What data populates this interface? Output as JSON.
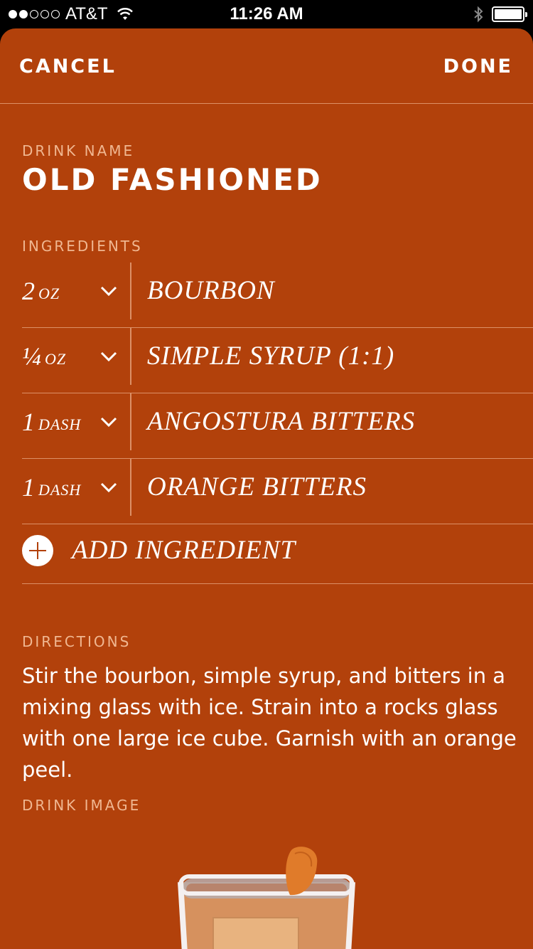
{
  "status_bar": {
    "carrier": "AT&T",
    "time": "11:26 AM",
    "signal_bars_filled": 2,
    "signal_bars_total": 5
  },
  "nav": {
    "cancel_label": "CANCEL",
    "done_label": "DONE"
  },
  "drink": {
    "name_label": "DRINK NAME",
    "name": "OLD FASHIONED"
  },
  "ingredients": {
    "label": "INGREDIENTS",
    "items": [
      {
        "qty": "2",
        "unit": "OZ",
        "name": "BOURBON"
      },
      {
        "qty": "¼",
        "unit": "OZ",
        "name": "SIMPLE SYRUP (1:1)"
      },
      {
        "qty": "1",
        "unit": "DASH",
        "name": "ANGOSTURA BITTERS"
      },
      {
        "qty": "1",
        "unit": "DASH",
        "name": "ORANGE BITTERS"
      }
    ],
    "add_label": "ADD INGREDIENT"
  },
  "directions": {
    "label": "DIRECTIONS",
    "text": "Stir the bourbon, simple syrup, and bitters in a mixing glass with ice. Strain into a rocks glass with one large ice cube. Garnish with an orange peel."
  },
  "drink_image": {
    "label": "DRINK IMAGE"
  },
  "colors": {
    "background": "#b2410b",
    "label": "#f0b791",
    "text": "#ffffff"
  }
}
